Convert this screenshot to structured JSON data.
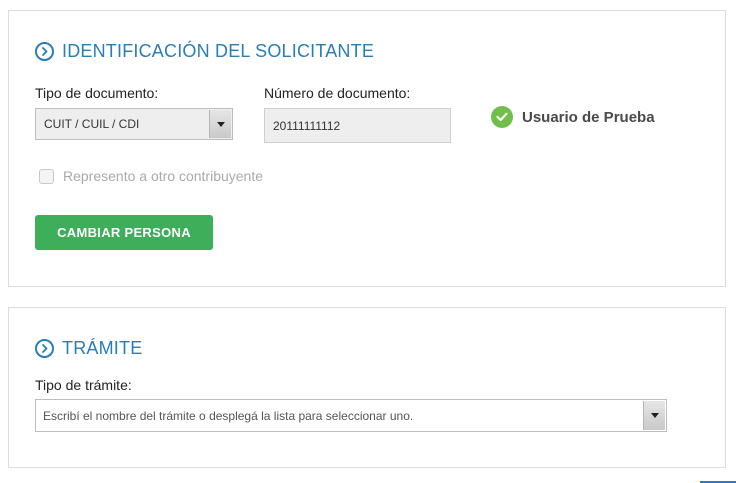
{
  "solicitante": {
    "title": "IDENTIFICACIÓN DEL SOLICITANTE",
    "tipo_doc_label": "Tipo de documento:",
    "tipo_doc_value": "CUIT / CUIL / CDI",
    "num_doc_label": "Número de documento:",
    "num_doc_value": "20111111112",
    "usuario": "Usuario de Prueba",
    "represento_label": "Represento a otro contribuyente",
    "represento_checked": false,
    "cambiar_button": "CAMBIAR PERSONA"
  },
  "tramite": {
    "title": "TRÁMITE",
    "tipo_label": "Tipo de trámite:",
    "tipo_placeholder": "Escribí el nombre del trámite o desplegá la lista para seleccionar uno."
  },
  "colors": {
    "accent": "#2a7db7",
    "button_green": "#3fae5a",
    "check_green": "#6fbf4a"
  },
  "icons": [
    "chevron-right-circle-icon",
    "check-circle-icon",
    "caret-down-icon"
  ]
}
